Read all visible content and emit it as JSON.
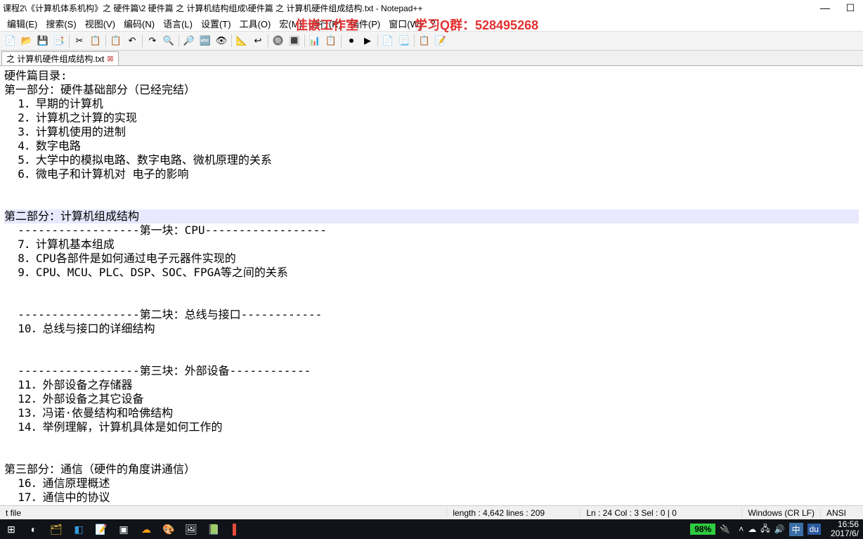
{
  "window": {
    "title": "课程2\\《计算机体系机构》之 硬件篇\\2 硬件篇 之 计算机结构组成\\硬件篇 之 计算机硬件组成结构.txt - Notepad++",
    "minimize": "—",
    "maximize": "☐"
  },
  "menu": {
    "items": [
      "编辑(E)",
      "搜索(S)",
      "视图(V)",
      "编码(N)",
      "语言(L)",
      "设置(T)",
      "工具(O)",
      "宏(M)",
      "运行(R)",
      "插件(P)",
      "窗口(W)",
      "?"
    ]
  },
  "overlay": {
    "studio": "佳嵌工作室",
    "qq": "学习Q群：528495268"
  },
  "tab": {
    "label": "之 计算机硬件组成结构.txt",
    "close": "⊠"
  },
  "editor": {
    "lines": [
      "硬件篇目录:",
      "第一部分：硬件基础部分（已经完结）",
      "  1．早期的计算机",
      "  2．计算机之计算的实现",
      "  3．计算机使用的进制",
      "  4．数字电路",
      "  5．大学中的模拟电路、数字电路、微机原理的关系",
      "  6．微电子和计算机对 电子的影响",
      "",
      "",
      "第二部分：计算机组成结构",
      "  ------------------第一块：CPU------------------",
      "  7．计算机基本组成",
      "  8．CPU各部件是如何通过电子元器件实现的",
      "  9．CPU、MCU、PLC、DSP、SOC、FPGA等之间的关系",
      "",
      "",
      "  ------------------第二块：总线与接口------------",
      "  10．总线与接口的详细结构",
      "",
      "",
      "  ------------------第三块：外部设备------------",
      "  11．外部设备之存储器",
      "  12．外部设备之其它设备",
      "  13．冯诺·依曼结构和哈佛结构",
      "  14．举例理解，计算机具体是如何工作的",
      "",
      "",
      "第三部分：通信（硬件的角度讲通信）",
      "  16．通信原理概述",
      "  17．通信中的协议"
    ],
    "caretLine": 10
  },
  "status": {
    "file": "t file",
    "length": "length : 4,642    lines : 209",
    "pos": "Ln : 24   Col : 3   Sel : 0 | 0",
    "eol": "Windows (CR LF)",
    "enc": "ANSI"
  },
  "taskbar": {
    "battery": "98%",
    "ime": "中",
    "du": "du",
    "time": "16:56",
    "date": "2017/6/"
  },
  "toolbar_icons": [
    "📄",
    "📂",
    "💾",
    "📑",
    "✂",
    "📋",
    "📋",
    "↶",
    "↷",
    "🔍",
    "🔎",
    "🔤",
    "👁",
    "📐",
    "↩",
    "🔘",
    "🔳",
    "📊",
    "📋",
    "⏺",
    "▶",
    "📄",
    "📃",
    "📋",
    "📝"
  ]
}
